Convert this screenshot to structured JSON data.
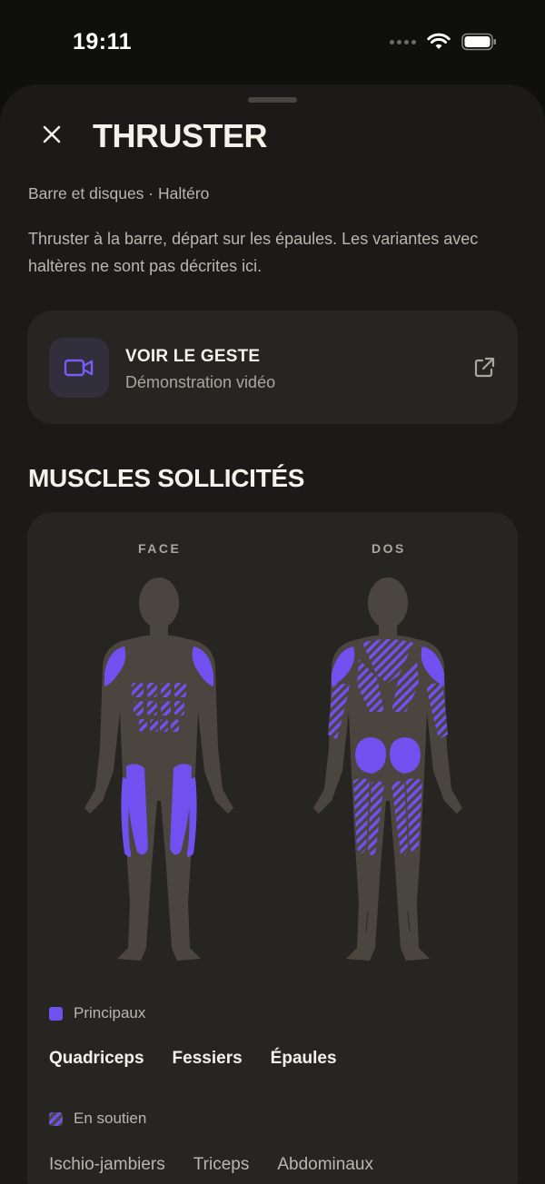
{
  "status": {
    "time": "19:11"
  },
  "exercise": {
    "title": "THRUSTER",
    "meta": "Barre et disques · Haltéro",
    "description": "Thruster à la barre, départ sur les épaules. Les variantes avec haltères ne sont pas décrites ici."
  },
  "video": {
    "title": "VOIR LE GESTE",
    "subtitle": "Démonstration vidéo",
    "icon": "video-camera-icon",
    "link_icon": "external-link-icon"
  },
  "muscles": {
    "section_title": "MUSCLES SOLLICITÉS",
    "front_label": "FACE",
    "back_label": "DOS",
    "primary_legend": "Principaux",
    "primary": [
      "Quadriceps",
      "Fessiers",
      "Épaules"
    ],
    "support_legend": "En soutien",
    "support": [
      "Ischio-jambiers",
      "Triceps",
      "Abdominaux"
    ]
  },
  "colors": {
    "background": "#1b1a18",
    "card": "#262522",
    "accent": "#7150f0",
    "body": "#4a463f"
  }
}
